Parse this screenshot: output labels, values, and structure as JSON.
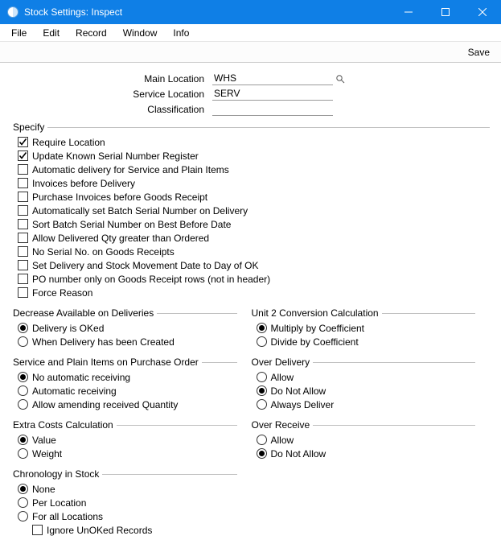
{
  "window": {
    "title": "Stock Settings: Inspect"
  },
  "menu": {
    "items": [
      "File",
      "Edit",
      "Record",
      "Window",
      "Info"
    ]
  },
  "toolbar": {
    "save_label": "Save"
  },
  "header": {
    "main_location_label": "Main Location",
    "main_location_value": "WHS",
    "service_location_label": "Service Location",
    "service_location_value": "SERV",
    "classification_label": "Classification",
    "classification_value": ""
  },
  "specify": {
    "legend": "Specify",
    "items": [
      {
        "label": "Require Location",
        "checked": true
      },
      {
        "label": "Update Known Serial Number Register",
        "checked": true
      },
      {
        "label": "Automatic delivery for Service and Plain Items",
        "checked": false
      },
      {
        "label": "Invoices before Delivery",
        "checked": false
      },
      {
        "label": "Purchase Invoices before Goods Receipt",
        "checked": false
      },
      {
        "label": "Automatically set Batch Serial Number on Delivery",
        "checked": false
      },
      {
        "label": "Sort Batch Serial Number on Best Before Date",
        "checked": false
      },
      {
        "label": "Allow Delivered Qty greater than Ordered",
        "checked": false
      },
      {
        "label": "No Serial No. on Goods Receipts",
        "checked": false
      },
      {
        "label": "Set Delivery and Stock Movement Date to Day of OK",
        "checked": false
      },
      {
        "label": "PO number only on Goods Receipt rows (not in header)",
        "checked": false
      },
      {
        "label": "Force Reason",
        "checked": false
      }
    ]
  },
  "decrease_available": {
    "legend": "Decrease Available on Deliveries",
    "options": [
      {
        "label": "Delivery is OKed",
        "selected": true
      },
      {
        "label": "When Delivery has been Created",
        "selected": false
      }
    ]
  },
  "unit2_conversion": {
    "legend": "Unit 2 Conversion Calculation",
    "options": [
      {
        "label": "Multiply by Coefficient",
        "selected": true
      },
      {
        "label": "Divide by Coefficient",
        "selected": false
      }
    ]
  },
  "service_plain_po": {
    "legend": "Service and Plain Items on Purchase Order",
    "options": [
      {
        "label": "No automatic receiving",
        "selected": true
      },
      {
        "label": "Automatic receiving",
        "selected": false
      },
      {
        "label": "Allow amending received Quantity",
        "selected": false
      }
    ]
  },
  "over_delivery": {
    "legend": "Over Delivery",
    "options": [
      {
        "label": "Allow",
        "selected": false
      },
      {
        "label": "Do Not Allow",
        "selected": true
      },
      {
        "label": "Always Deliver",
        "selected": false
      }
    ]
  },
  "extra_costs": {
    "legend": "Extra Costs Calculation",
    "options": [
      {
        "label": "Value",
        "selected": true
      },
      {
        "label": "Weight",
        "selected": false
      }
    ]
  },
  "over_receive": {
    "legend": "Over Receive",
    "options": [
      {
        "label": "Allow",
        "selected": false
      },
      {
        "label": "Do Not Allow",
        "selected": true
      }
    ]
  },
  "chronology": {
    "legend": "Chronology in Stock",
    "options": [
      {
        "label": "None",
        "selected": true
      },
      {
        "label": "Per Location",
        "selected": false
      },
      {
        "label": "For all Locations",
        "selected": false
      }
    ],
    "sub_checkbox": {
      "label": "Ignore UnOKed Records",
      "checked": false
    }
  }
}
